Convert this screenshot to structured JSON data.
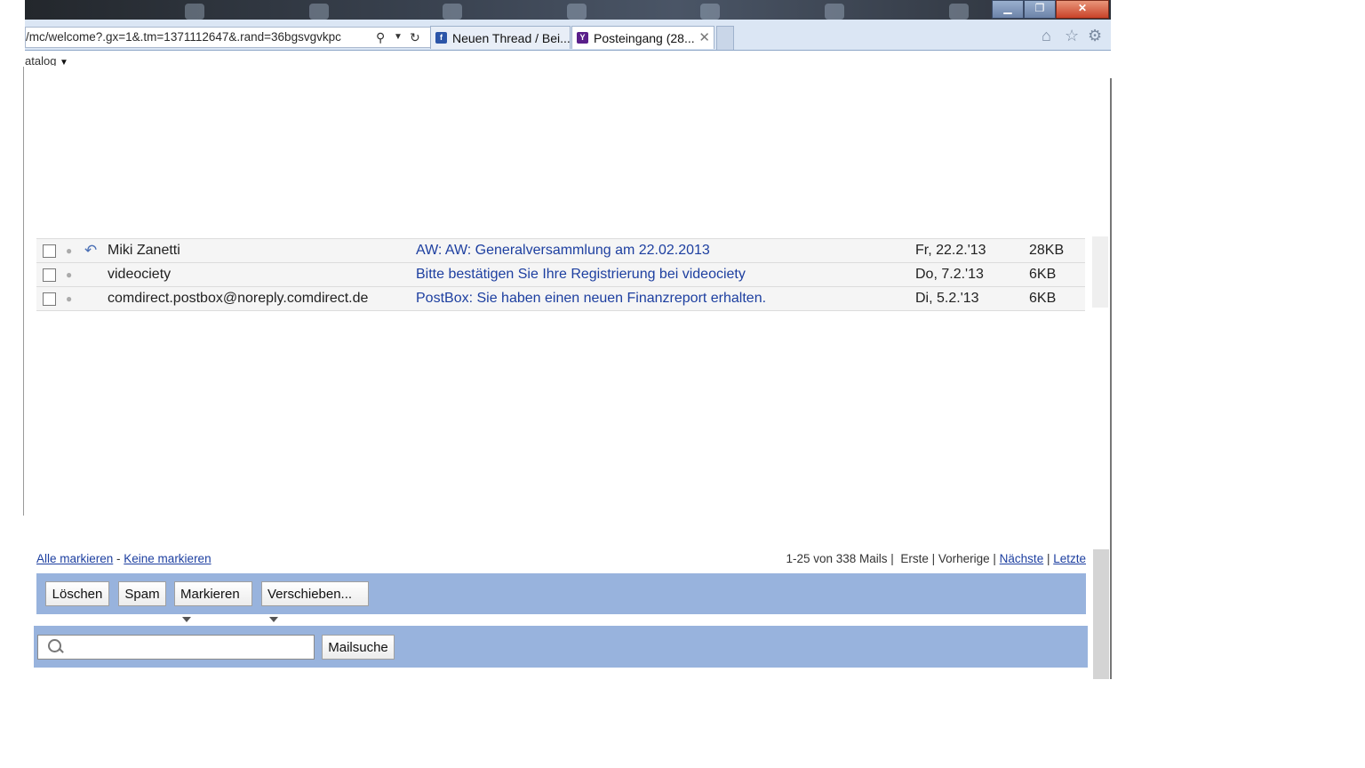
{
  "browser": {
    "url": "/mc/welcome?.gx=1&.tm=1371112647&.rand=36bgsvgvkpc",
    "tabs": [
      {
        "label": "Neuen Thread / Bei..."
      },
      {
        "label": "Posteingang (28..."
      }
    ],
    "favorites_label": "atalog"
  },
  "mails": [
    {
      "sender": "Miki Zanetti",
      "subject": "AW: AW: Generalversammlung am 22.02.2013",
      "date": "Fr, 22.2.'13",
      "size": "28KB",
      "replied": true
    },
    {
      "sender": "videociety",
      "subject": "Bitte bestätigen Sie Ihre Registrierung bei videociety",
      "date": "Do, 7.2.'13",
      "size": "6KB",
      "replied": false
    },
    {
      "sender": "comdirect.postbox@noreply.comdirect.de",
      "subject": "PostBox: Sie haben einen neuen Finanzreport erhalten.",
      "date": "Di, 5.2.'13",
      "size": "6KB",
      "replied": false
    }
  ],
  "footer": {
    "select_all": "Alle markieren",
    "separator": " - ",
    "select_none": "Keine markieren",
    "count": "1-25 von 338 Mails | ",
    "first": "Erste",
    "prev": "Vorherige",
    "next": "Nächste",
    "last": "Letzte"
  },
  "toolbar": {
    "delete": "Löschen",
    "spam": "Spam",
    "mark": "Markieren",
    "move": "Verschieben..."
  },
  "search": {
    "placeholder": "",
    "button": "Mailsuche"
  },
  "colors": {
    "toolbar_bg": "#98b3dd",
    "link": "#1d3fa0"
  }
}
